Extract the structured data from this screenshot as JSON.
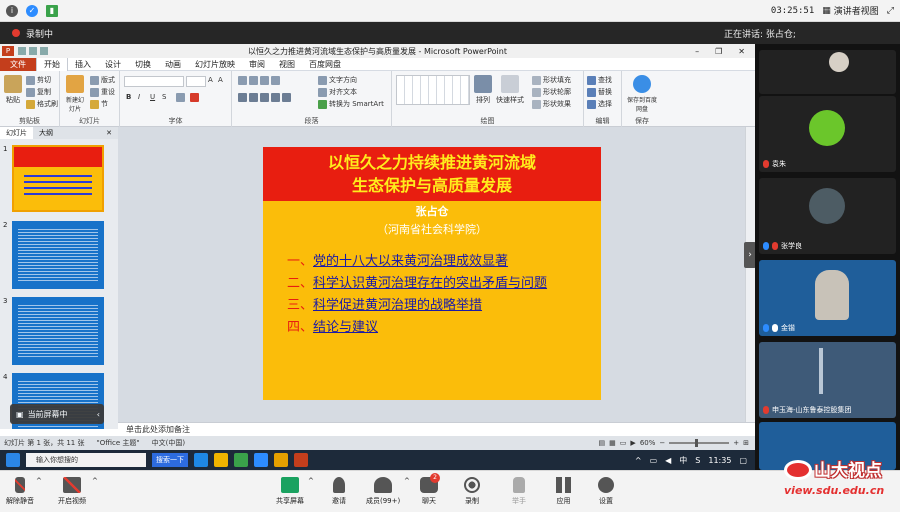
{
  "zoom_top": {
    "time": "03:25:51",
    "view_label": "演讲者视图"
  },
  "recording": {
    "label": "录制中"
  },
  "speaking": {
    "label": "正在讲话: 张占仓;"
  },
  "ppt": {
    "window_title": "以恒久之力推进黄河流域生态保护与高质量发展 - Microsoft PowerPoint",
    "tabs": [
      "文件",
      "开始",
      "插入",
      "设计",
      "切换",
      "动画",
      "幻灯片放映",
      "审阅",
      "视图",
      "百度网盘"
    ],
    "ribbon": {
      "clipboard": {
        "label": "剪贴板",
        "paste": "粘贴",
        "cut": "剪切",
        "copy": "复制",
        "format_painter": "格式刷"
      },
      "slides": {
        "label": "幻灯片",
        "new_slide": "新建幻灯片",
        "layout": "版式",
        "reset": "重设",
        "section": "节"
      },
      "font": {
        "label": "字体",
        "bold": "B",
        "italic": "I",
        "underline": "U",
        "strike": "S"
      },
      "paragraph": {
        "label": "段落",
        "text_direction": "文字方向",
        "align_text": "对齐文本",
        "smartart": "转换为 SmartArt"
      },
      "drawing": {
        "label": "绘图",
        "arrange": "排列",
        "quick_styles": "快速样式",
        "shape_fill": "形状填充",
        "shape_outline": "形状轮廓",
        "shape_effects": "形状效果"
      },
      "editing": {
        "label": "编辑",
        "find": "查找",
        "replace": "替换",
        "select": "选择"
      },
      "save": {
        "label": "保存",
        "baidu": "保存到百度网盘"
      }
    },
    "panes": {
      "slides_tab": "幻灯片",
      "outline_tab": "大纲"
    },
    "thumb_nums": [
      "1",
      "2",
      "3",
      "4"
    ],
    "presenting_banner": "当前屏幕中",
    "slide": {
      "title_line1": "以恒久之力持续推进黄河流域",
      "title_line2": "生态保护与高质量发展",
      "author": "张占仓",
      "institution": "（河南省社会科学院）",
      "items": [
        {
          "num": "一、",
          "text": "党的十八大以来黄河治理成效显著"
        },
        {
          "num": "二、",
          "text": "科学认识黄河治理存在的突出矛盾与问题"
        },
        {
          "num": "三、",
          "text": "科学促进黄河治理的战略举措"
        },
        {
          "num": "四、",
          "text": "结论与建议"
        }
      ]
    },
    "notes_placeholder": "单击此处添加备注",
    "status": {
      "slide_info": "幻灯片 第 1 张，共 11 张",
      "theme": "\"Office 主题\"",
      "language": "中文(中国)",
      "zoom": "60%"
    }
  },
  "taskbar": {
    "search_placeholder": "输入你想搜的",
    "search_btn": "搜索一下",
    "tray_lang": "中",
    "tray_s": "S",
    "tray_time": "11:35"
  },
  "zoom_bottom": {
    "unmute": "解除静音",
    "start_video": "开启视频",
    "share": "共享屏幕",
    "invite": "邀请",
    "participants": "成员(99+)",
    "chat": "聊天",
    "chat_badge": "2",
    "record": "录制",
    "raise_hand": "举手",
    "apps": "应用",
    "settings": "设置"
  },
  "participants": [
    {
      "name": ""
    },
    {
      "name": "袁朱"
    },
    {
      "name": "张学良"
    },
    {
      "name": "金锴"
    },
    {
      "name": "申玉海-山东鲁泰控股集团"
    }
  ],
  "watermark": {
    "title": "山大视点",
    "url": "view.sdu.edu.cn"
  },
  "colors": {
    "slide_red": "#e81e10",
    "slide_yellow": "#fbbd0a",
    "slide_title_text": "#ffec1c",
    "ppt_accent": "#c43e1c",
    "zoom_blue": "#2d8cff"
  }
}
